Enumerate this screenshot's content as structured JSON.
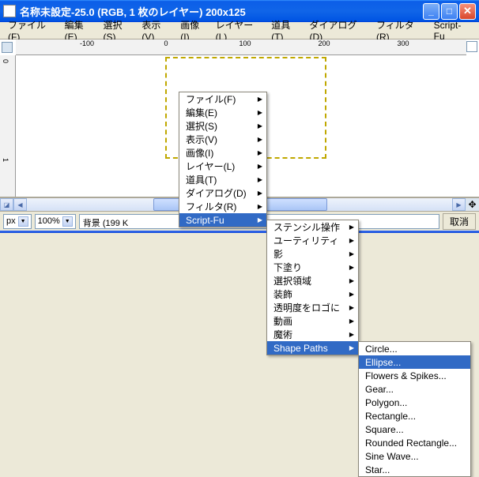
{
  "window": {
    "title": "名称未設定-25.0 (RGB, 1 枚のレイヤー) 200x125"
  },
  "menubar": {
    "file": "ファイル(F)",
    "edit": "編集(E)",
    "select": "選択(S)",
    "view": "表示(V)",
    "image": "画像(I)",
    "layer": "レイヤー(L)",
    "tools": "道具(T)",
    "dialogs": "ダイアログ(D)",
    "filters": "フィルタ(R)",
    "scriptfu": "Script-Fu"
  },
  "ruler_h": [
    "-100",
    "0",
    "100",
    "200",
    "300"
  ],
  "ruler_v": [
    "0",
    "1"
  ],
  "status": {
    "unit": "px",
    "zoom": "100%",
    "text": "背景 (199 K",
    "cancel": "取消"
  },
  "ctx1": {
    "items": [
      {
        "label": "ファイル(F)",
        "sub": true
      },
      {
        "label": "編集(E)",
        "sub": true
      },
      {
        "label": "選択(S)",
        "sub": true
      },
      {
        "label": "表示(V)",
        "sub": true
      },
      {
        "label": "画像(I)",
        "sub": true
      },
      {
        "label": "レイヤー(L)",
        "sub": true
      },
      {
        "label": "道具(T)",
        "sub": true
      },
      {
        "label": "ダイアログ(D)",
        "sub": true
      },
      {
        "label": "フィルタ(R)",
        "sub": true
      },
      {
        "label": "Script-Fu",
        "sub": true,
        "sel": true
      }
    ]
  },
  "ctx2": {
    "items": [
      {
        "label": "ステンシル操作",
        "sub": true
      },
      {
        "label": "ユーティリティ",
        "sub": true
      },
      {
        "label": "影",
        "sub": true
      },
      {
        "label": "下塗り",
        "sub": true
      },
      {
        "label": "選択領域",
        "sub": true
      },
      {
        "label": "装飾",
        "sub": true
      },
      {
        "label": "透明度をロゴに",
        "sub": true
      },
      {
        "label": "動画",
        "sub": true
      },
      {
        "label": "魔術",
        "sub": true
      },
      {
        "label": "Shape Paths",
        "sub": true,
        "sel": true
      }
    ]
  },
  "ctx3": {
    "items": [
      {
        "label": "Circle..."
      },
      {
        "label": "Ellipse...",
        "sel": true
      },
      {
        "label": "Flowers & Spikes..."
      },
      {
        "label": "Gear..."
      },
      {
        "label": "Polygon..."
      },
      {
        "label": "Rectangle..."
      },
      {
        "label": "Square..."
      },
      {
        "label": "Rounded Rectangle..."
      },
      {
        "label": "Sine Wave..."
      },
      {
        "label": "Star..."
      }
    ]
  }
}
